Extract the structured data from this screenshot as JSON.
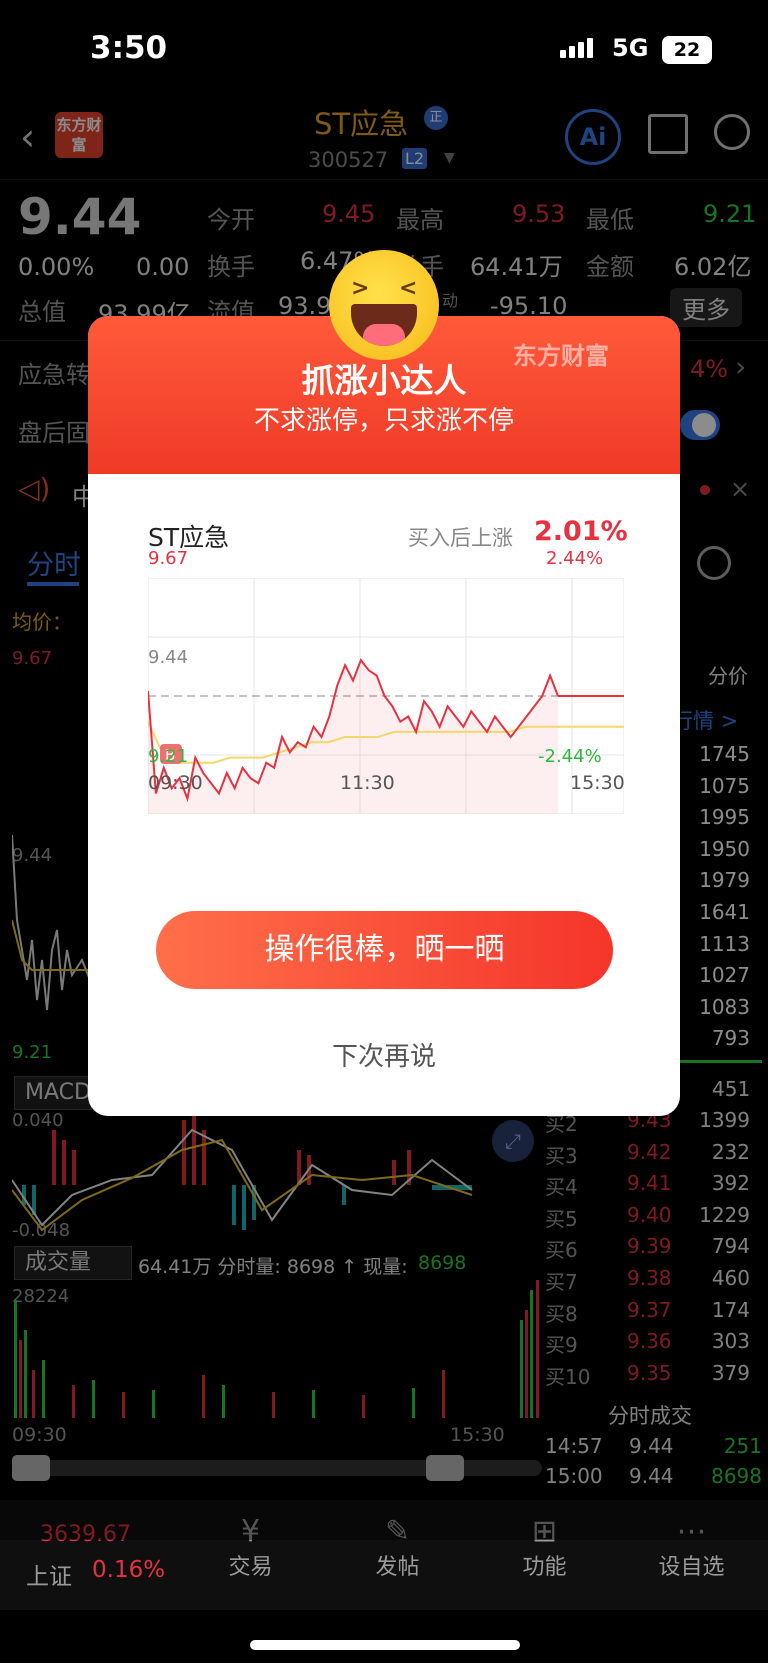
{
  "status_bar": {
    "time": "3:50",
    "network": "5G",
    "battery": "22"
  },
  "header": {
    "title": "ST应急",
    "badge": "正",
    "code": "300527",
    "level": "L2",
    "logo_text": "东方财富",
    "ai_label": "Ai"
  },
  "quote": {
    "price": "9.44",
    "change_pct": "0.00%",
    "change": "0.00",
    "open_label": "今开",
    "open": "9.45",
    "high_label": "最高",
    "high": "9.53",
    "low_label": "最低",
    "low": "9.21",
    "turnover_label": "换手",
    "turnover": "6.47%",
    "volume_label": "总手",
    "volume": "64.41万",
    "amount_label": "金额",
    "amount": "6.02亿",
    "mktcap_label": "总值",
    "mktcap": "93.99亿",
    "float_label": "流值",
    "float": "93.9",
    "pe_label": "动",
    "pe": "-95.10",
    "more_button": "更多"
  },
  "rows": {
    "row1_label": "应急转",
    "row1_pct": "4%",
    "row2_label": "盘后固",
    "row3_label": "中"
  },
  "chart_tabs": {
    "tab1": "分时"
  },
  "left_chart": {
    "avg_label": "均价：",
    "top": "9.67",
    "mid": "9.44",
    "bottom": "9.21",
    "macd": "MACD",
    "macd_top": "0.040",
    "macd_bot": "-0.048",
    "vol_label": "成交量",
    "vol_info": "64.41万 分时量: 8698 ↑ 现量: ",
    "vol_now": "8698",
    "vol_max": "28224",
    "t_start": "09:30",
    "t_end": "15:30"
  },
  "side": {
    "fenjia": "分价",
    "hangqing": "行情 >",
    "sell_vols": [
      "1745",
      "1075",
      "1995",
      "1950",
      "1979",
      "1641",
      "1113",
      "1027",
      "1083",
      "793"
    ],
    "buy_first_vol": "451",
    "buy": [
      {
        "label": "买2",
        "price": "9.43",
        "vol": "1399"
      },
      {
        "label": "买3",
        "price": "9.42",
        "vol": "232"
      },
      {
        "label": "买4",
        "price": "9.41",
        "vol": "392"
      },
      {
        "label": "买5",
        "price": "9.40",
        "vol": "1229"
      },
      {
        "label": "买6",
        "price": "9.39",
        "vol": "794"
      },
      {
        "label": "买7",
        "price": "9.38",
        "vol": "460"
      },
      {
        "label": "买8",
        "price": "9.37",
        "vol": "174"
      },
      {
        "label": "买9",
        "price": "9.36",
        "vol": "303"
      },
      {
        "label": "买10",
        "price": "9.35",
        "vol": "379"
      }
    ],
    "ticks_title": "分时成交",
    "ticks": [
      {
        "time": "14:57",
        "price": "9.44",
        "vol": "251"
      },
      {
        "time": "15:00",
        "price": "9.44",
        "vol": "8698"
      }
    ]
  },
  "tabbar": {
    "index_value": "3639.67",
    "index_name": "上证",
    "index_pct": "0.16%",
    "items": [
      "交易",
      "发帖",
      "功能",
      "设自选"
    ]
  },
  "modal": {
    "brand": "东方财富",
    "title": "抓涨小达人",
    "subtitle": "不求涨停，只求涨不停",
    "stock": "ST应急",
    "gain_label": "买入后上涨",
    "gain": "2.01%",
    "y_top": "9.67",
    "y_mid": "9.44",
    "y_bot": "9.21",
    "pct_top": "2.44%",
    "pct_bot": "-2.44%",
    "x_start": "09:30",
    "x_mid": "11:30",
    "x_end": "15:30",
    "marker": "B",
    "share_button": "操作很棒，晒一晒",
    "dismiss": "下次再说"
  },
  "chart_data": {
    "type": "line",
    "title": "ST应急",
    "x_ticks": [
      "09:30",
      "11:30",
      "15:30"
    ],
    "ylim": [
      9.21,
      9.67
    ],
    "reference": 9.44,
    "series": [
      {
        "values": [
          9.45,
          9.25,
          9.3,
          9.26,
          9.28,
          9.24,
          9.32,
          9.29,
          9.27,
          9.25,
          9.29,
          9.26,
          9.3,
          9.28,
          9.27,
          9.31,
          9.3,
          9.36,
          9.33,
          9.35,
          9.34,
          9.38,
          9.36,
          9.4,
          9.46,
          9.5,
          9.47,
          9.51,
          9.49,
          9.48,
          9.44,
          9.42,
          9.39,
          9.4,
          9.37,
          9.43,
          9.41,
          9.38,
          9.42,
          9.4,
          9.38,
          9.41,
          9.39,
          9.37,
          9.4,
          9.38,
          9.36,
          9.38,
          9.4,
          9.42,
          9.44,
          9.48,
          9.44
        ]
      },
      {
        "values": [
          9.39,
          9.32,
          9.31,
          9.31,
          9.31,
          9.32,
          9.32,
          9.32,
          9.33,
          9.34,
          9.35,
          9.35,
          9.36,
          9.36,
          9.36,
          9.37,
          9.37,
          9.37,
          9.37,
          9.37,
          9.37,
          9.37,
          9.37,
          9.38,
          9.38,
          9.38,
          9.38,
          9.38,
          9.38
        ]
      }
    ]
  }
}
